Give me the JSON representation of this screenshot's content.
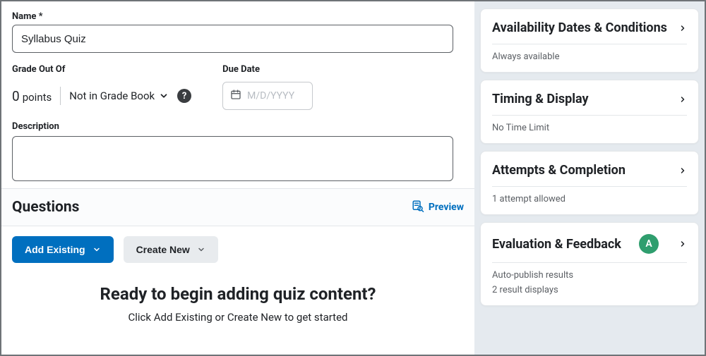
{
  "form": {
    "name_label": "Name *",
    "name_value": "Syllabus Quiz",
    "grade_label": "Grade Out Of",
    "points_number": "0",
    "points_word": "points",
    "gradebook_label": "Not in Grade Book",
    "due_label": "Due Date",
    "due_placeholder": "M/D/YYYY",
    "description_label": "Description",
    "description_value": ""
  },
  "questions": {
    "heading": "Questions",
    "preview_label": "Preview",
    "add_existing_label": "Add Existing",
    "create_new_label": "Create New",
    "empty_title": "Ready to begin adding quiz content?",
    "empty_sub": "Click Add Existing or Create New to get started"
  },
  "sidebar": {
    "panels": [
      {
        "title": "Availability Dates & Conditions",
        "lines": [
          "Always available"
        ],
        "badge": null
      },
      {
        "title": "Timing & Display",
        "lines": [
          "No Time Limit"
        ],
        "badge": null
      },
      {
        "title": "Attempts & Completion",
        "lines": [
          "1 attempt allowed"
        ],
        "badge": null
      },
      {
        "title": "Evaluation & Feedback",
        "lines": [
          "Auto-publish results",
          "2 result displays"
        ],
        "badge": "A"
      }
    ]
  },
  "icons": {
    "help": "?"
  }
}
